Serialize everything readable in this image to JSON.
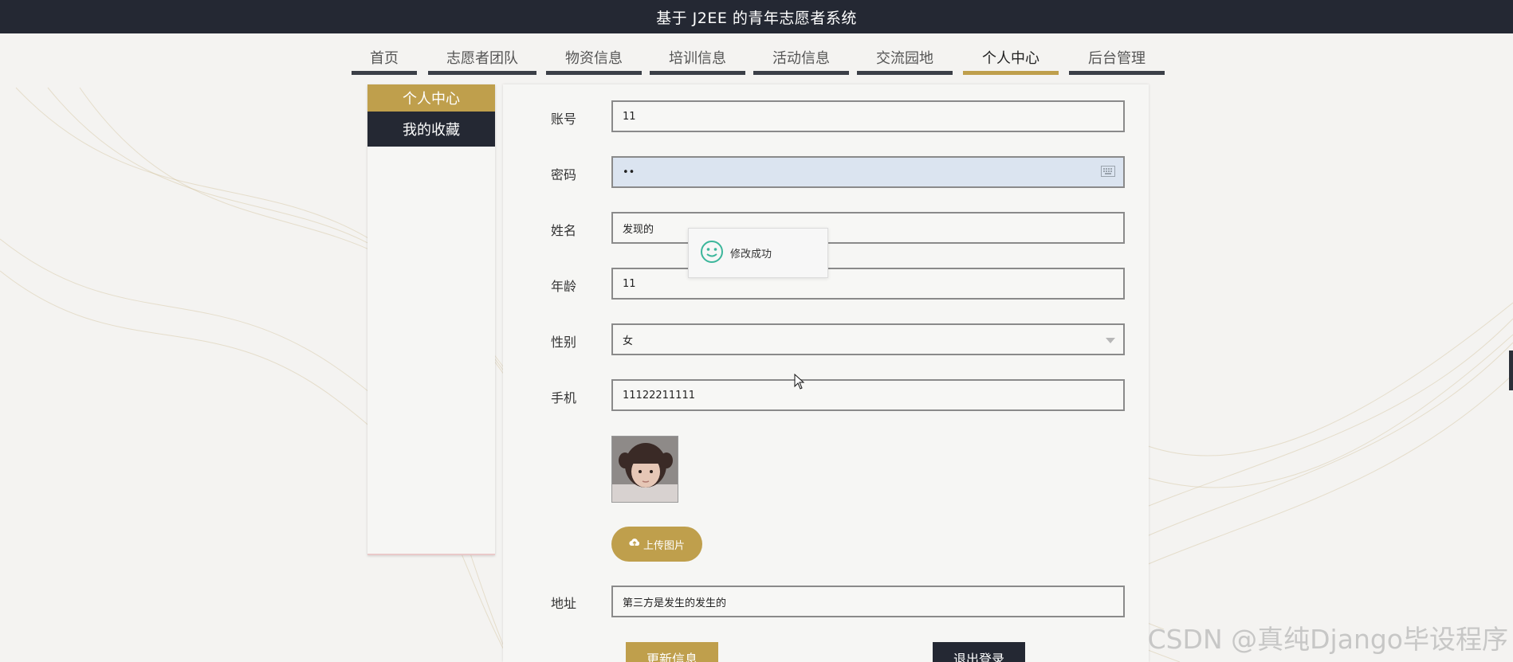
{
  "header": {
    "title": "基于 J2EE 的青年志愿者系统"
  },
  "nav": {
    "items": [
      {
        "label": "首页",
        "active": false
      },
      {
        "label": "志愿者团队",
        "active": false
      },
      {
        "label": "物资信息",
        "active": false
      },
      {
        "label": "培训信息",
        "active": false
      },
      {
        "label": "活动信息",
        "active": false
      },
      {
        "label": "交流园地",
        "active": false
      },
      {
        "label": "个人中心",
        "active": true
      },
      {
        "label": "后台管理",
        "active": false
      }
    ]
  },
  "side_menu": {
    "items": [
      {
        "label": "个人中心",
        "active": true
      },
      {
        "label": "我的收藏",
        "active": false
      }
    ]
  },
  "form": {
    "account": {
      "label": "账号",
      "value": "11"
    },
    "password": {
      "label": "密码",
      "value": "••"
    },
    "name": {
      "label": "姓名",
      "value": "发现的"
    },
    "age": {
      "label": "年龄",
      "value": "11"
    },
    "gender": {
      "label": "性别",
      "value": "女"
    },
    "phone": {
      "label": "手机",
      "value": "11122211111"
    },
    "upload_label": "上传图片",
    "address": {
      "label": "地址",
      "value": "第三方是发生的发生的"
    },
    "update_label": "更新信息",
    "logout_label": "退出登录"
  },
  "toast": {
    "message": "修改成功",
    "icon": "smile-icon"
  },
  "watermark": "CSDN @真纯Django毕设程序",
  "colors": {
    "accent": "#bf9f4c",
    "dark": "#242833",
    "toast_icon": "#3cb69b"
  }
}
